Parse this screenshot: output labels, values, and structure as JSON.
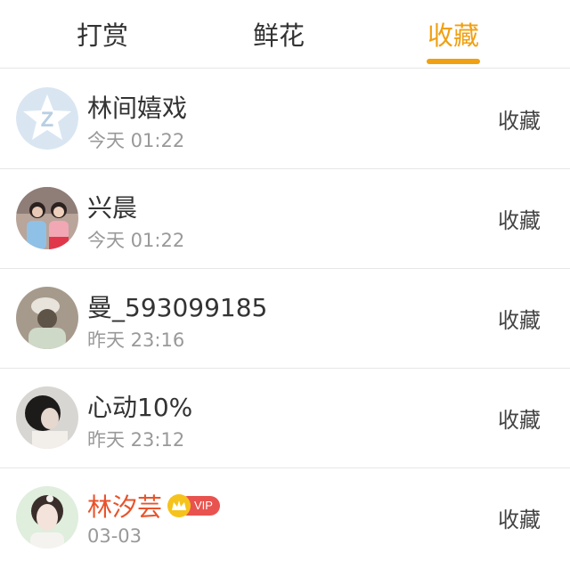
{
  "tabs": [
    {
      "label": "打赏",
      "active": false
    },
    {
      "label": "鲜花",
      "active": false
    },
    {
      "label": "收藏",
      "active": true
    }
  ],
  "accent_color": "#f0a013",
  "items": [
    {
      "name": "林间嬉戏",
      "time": "今天 01:22",
      "action": "收藏",
      "avatar": "default-qq-avatar"
    },
    {
      "name": "兴晨",
      "time": "今天 01:22",
      "action": "收藏",
      "avatar": "photo-avatar"
    },
    {
      "name": "曼_593099185",
      "time": "昨天 23:16",
      "action": "收藏",
      "avatar": "photo-avatar"
    },
    {
      "name": "心动10%",
      "time": "昨天 23:12",
      "action": "收藏",
      "avatar": "photo-avatar"
    },
    {
      "name": "林汐芸",
      "time": "03-03",
      "action": "收藏",
      "avatar": "photo-avatar",
      "vip_label": "VIP",
      "name_color": "#e8532b"
    }
  ]
}
